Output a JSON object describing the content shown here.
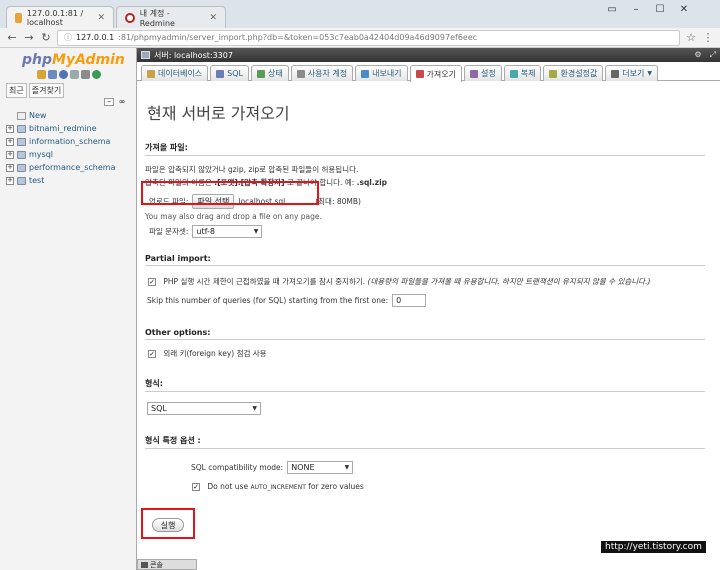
{
  "browser": {
    "tabs": [
      {
        "title": "127.0.0.1:81 / localhost"
      },
      {
        "title": "내 계정 - Redmine"
      }
    ],
    "url_host": "127.0.0.1",
    "url_rest": ":81/phpmyadmin/server_import.php?db=&token=053c7eab0a42404d09a46d9097ef6eec"
  },
  "sidebar": {
    "logo_php": "php",
    "logo_myadmin": "MyAdmin",
    "tabs": [
      "최근",
      "즐겨찾기"
    ],
    "databases": [
      {
        "name": "New"
      },
      {
        "name": "bitnami_redmine"
      },
      {
        "name": "information_schema"
      },
      {
        "name": "mysql"
      },
      {
        "name": "performance_schema"
      },
      {
        "name": "test"
      }
    ]
  },
  "server_bar": {
    "label": "서버: localhost:3307"
  },
  "menu_tabs": [
    {
      "label": "데이터베이스",
      "color": "#c8a24a"
    },
    {
      "label": "SQL",
      "color": "#6a7fb5"
    },
    {
      "label": "상태",
      "color": "#5a9a5a"
    },
    {
      "label": "사용자 계정",
      "color": "#8a8a8a"
    },
    {
      "label": "내보내기",
      "color": "#4a8ac8"
    },
    {
      "label": "가져오기",
      "color": "#c84a4a"
    },
    {
      "label": "설정",
      "color": "#8a6aa8"
    },
    {
      "label": "복제",
      "color": "#4aa8a8"
    },
    {
      "label": "환경설정값",
      "color": "#a8a84a"
    },
    {
      "label": "더보기",
      "color": "#666666"
    }
  ],
  "page": {
    "title": "현재 서버로 가져오기",
    "file_section": {
      "title": "가져올 파일:",
      "line1": "파일은 압축되지 않았거나 gzip, zip로 압축된 파일들이 허용됩니다.",
      "line2_a": "압축된 파일의 이름은 ",
      "line2_b": ".[포맷].[압축 확장자]",
      "line2_c": " 로 끝나야 합니다. 예: ",
      "line2_d": ".sql.zip",
      "upload_label": "업로드 파일:",
      "browse_button": "파일 선택",
      "file_name": "localhost.sql",
      "max_size": "(최대: 80MB)",
      "drag_hint": "You may also drag and drop a file on any page.",
      "charset_label": "파일 문자셋:",
      "charset_value": "utf-8"
    },
    "partial_section": {
      "title": "Partial import:",
      "interrupt_label": "PHP 실행 시간 제한이 근접하였을 때 가져오기를 잠시 중지하기.",
      "interrupt_note": "(대용량의 파일들을 가져올 때 유용합니다. 하지만 트랜잭션이 유지되지 않을 수 있습니다.)",
      "skip_label": "Skip this number of queries (for SQL) starting from the first one:",
      "skip_value": "0"
    },
    "other_section": {
      "title": "Other options:",
      "fk_label": "외래 키(foreign key) 점검 사용"
    },
    "format_section": {
      "title": "형식:",
      "value": "SQL"
    },
    "format_options": {
      "title": "형식 특정 옵션 :",
      "compat_label": "SQL compatibility mode:",
      "compat_value": "NONE",
      "auto_inc_a": "Do not use ",
      "auto_inc_b": "AUTO_INCREMENT",
      "auto_inc_c": " for zero values"
    },
    "go_button": "실행"
  },
  "console_label": "콘솔",
  "watermark": "http://yeti.tistory.com"
}
